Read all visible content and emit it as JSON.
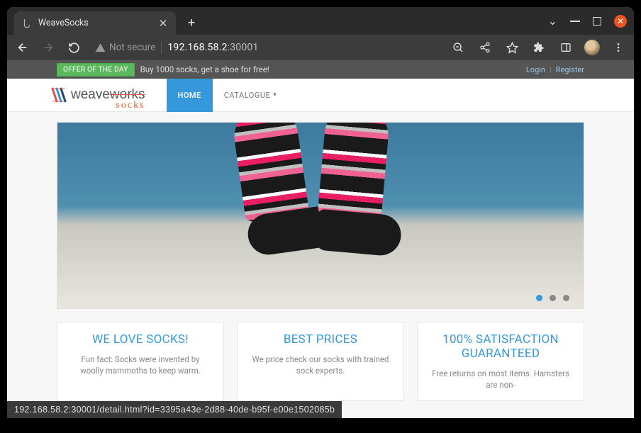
{
  "browser": {
    "tab_title": "WeaveSocks",
    "address": {
      "security_label": "Not secure",
      "host": "192.168.58.2",
      "port_path": ":30001"
    },
    "status_url": "192.168.58.2:30001/detail.html?id=3395a43e-2d88-40de-b95f-e00e1502085b"
  },
  "offer_bar": {
    "badge": "OFFER OF THE DAY",
    "text": "Buy 1000 socks, get a shoe for free!",
    "login": "Login",
    "register": "Register"
  },
  "logo": {
    "main": "weave",
    "struck": "works",
    "sub": "socks"
  },
  "nav": {
    "home": "HOME",
    "catalogue": "CATALOGUE"
  },
  "promos": [
    {
      "title": "WE LOVE SOCKS!",
      "body": "Fun fact: Socks were invented by woolly mammoths to keep warm."
    },
    {
      "title": "BEST PRICES",
      "body": "We price check our socks with trained sock experts."
    },
    {
      "title": "100% SATISFACTION GUARANTEED",
      "body": "Free returns on most items. Hamsters are non-"
    }
  ]
}
